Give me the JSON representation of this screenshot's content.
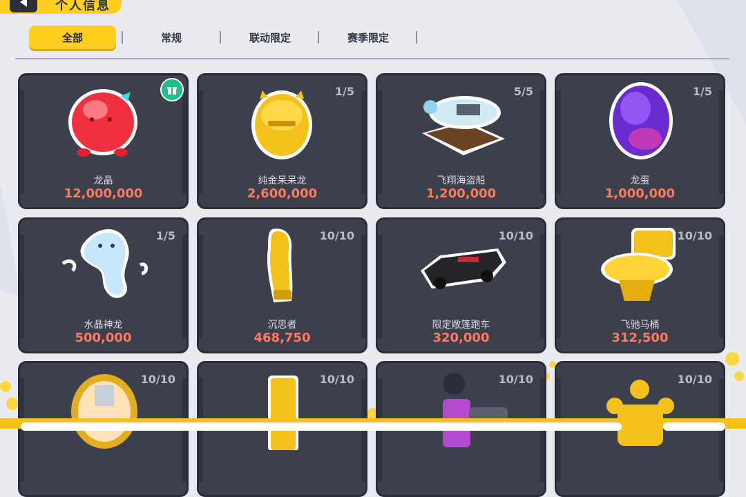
{
  "header": {
    "title": "个人信息"
  },
  "tabs": [
    {
      "label": "全部",
      "active": true
    },
    {
      "label": "常规",
      "active": false
    },
    {
      "label": "联动限定",
      "active": false
    },
    {
      "label": "赛季限定",
      "active": false
    }
  ],
  "items": [
    {
      "name": "龙晶",
      "value": "12,000,000",
      "count": "",
      "icon": "red-jelly-dragon-icon",
      "badge": "gift-icon"
    },
    {
      "name": "纯金呆呆龙",
      "value": "2,600,000",
      "count": "1/5",
      "icon": "gold-dragon-statue-icon"
    },
    {
      "name": "飞翔海盗船",
      "value": "1,200,000",
      "count": "5/5",
      "icon": "ship-in-bottle-icon"
    },
    {
      "name": "龙蛋",
      "value": "1,000,000",
      "count": "1/5",
      "icon": "dragon-egg-icon"
    },
    {
      "name": "水晶神龙",
      "value": "500,000",
      "count": "1/5",
      "icon": "crystal-dragon-icon"
    },
    {
      "name": "沉思者",
      "value": "468,750",
      "count": "10/10",
      "icon": "thinker-statue-icon"
    },
    {
      "name": "限定敞篷跑车",
      "value": "320,000",
      "count": "10/10",
      "icon": "convertible-car-icon"
    },
    {
      "name": "飞驰马桶",
      "value": "312,500",
      "count": "10/10",
      "icon": "gold-toilet-icon"
    },
    {
      "name": "",
      "value": "",
      "count": "10/10",
      "icon": "portrait-frame-icon"
    },
    {
      "name": "",
      "value": "",
      "count": "10/10",
      "icon": "gold-bar-icon"
    },
    {
      "name": "",
      "value": "",
      "count": "10/10",
      "icon": "robot-cannon-icon"
    },
    {
      "name": "",
      "value": "",
      "count": "10/10",
      "icon": "gold-crown-icon"
    }
  ],
  "colors": {
    "accent": "#ffcf1f",
    "card": "#3b404c",
    "value": "#ff7a5c"
  }
}
